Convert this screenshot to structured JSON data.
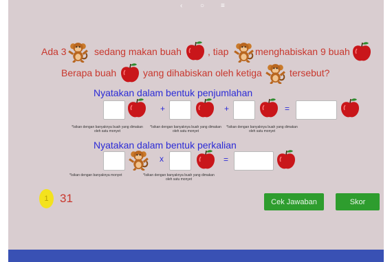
{
  "question": {
    "line1": {
      "part1": "Ada 3",
      "part2": "sedang makan buah",
      "part3": ", tiap",
      "part4": "menghabiskan 9 buah"
    },
    "line2": {
      "part1": "Berapa buah",
      "part2": "yang dihabiskan oleh ketiga",
      "part3": "tersebut?"
    }
  },
  "sum_section": {
    "heading": "Nyatakan dalam bentuk penjumlahan",
    "plus1": "+",
    "plus2": "+",
    "equals": "=",
    "note": "*Isikan dengan banyaknya buah yang dimakan oleh satu monyet"
  },
  "product_section": {
    "heading": "Nyatakan dalam bentuk perkalian",
    "times": "x",
    "equals": "=",
    "note_left": "*Isikan dengan banyaknya monyet",
    "note_right": "*Isikan dengan banyaknya buah yang dimakan oleh satu monyet"
  },
  "score": {
    "value": "31",
    "badge_text": "1"
  },
  "buttons": {
    "check": "Cek Jawaban",
    "score": "Skor"
  },
  "navbar": {
    "back": "‹",
    "home": "○",
    "menu": "≡"
  },
  "icons": {
    "monkey": "monkey-icon",
    "apple": "apple-icon",
    "coin": "coin-icon"
  },
  "colors": {
    "background": "#d9cdd0",
    "question_text": "#c8372d",
    "heading_text": "#2b2bd6",
    "button": "#2e9d2e",
    "navbar": "#3951b4",
    "coin": "#f3e21e"
  }
}
